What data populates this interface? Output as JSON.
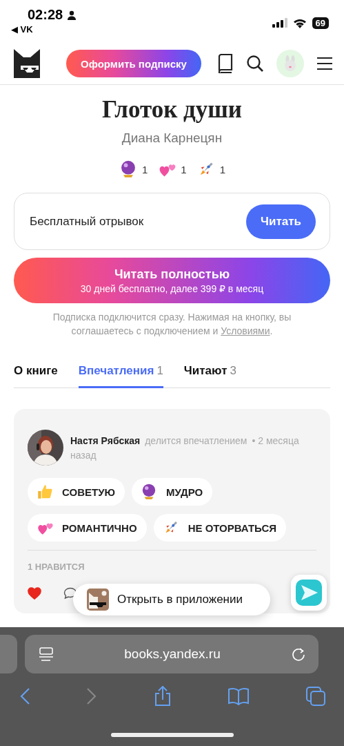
{
  "status_bar": {
    "time": "02:28",
    "back_app": "◀ VK",
    "battery": "69"
  },
  "header": {
    "subscribe_button": "Оформить подписку"
  },
  "book": {
    "title": "Глоток души",
    "author": "Диана Карнецян",
    "reactions": [
      {
        "kind": "crystal-ball",
        "count": "1"
      },
      {
        "kind": "hearts",
        "count": "1"
      },
      {
        "kind": "rocket",
        "count": "1"
      }
    ]
  },
  "free_excerpt": {
    "label": "Бесплатный отрывок",
    "button": "Читать"
  },
  "read_full": {
    "title": "Читать полностью",
    "subtitle": "30 дней бесплатно, далее 399 ₽ в месяц"
  },
  "notice": {
    "text": "Подписка подключится сразу. Нажимая на кнопку, вы соглашаетесь с подключением и",
    "link": "Условиями",
    "end": "."
  },
  "tabs": [
    {
      "label": "О книге",
      "selected": false
    },
    {
      "label": "Впечатления",
      "count": "1",
      "selected": true
    },
    {
      "label": "Читают",
      "count": "3",
      "selected": false
    }
  ],
  "review": {
    "author": "Настя Рябская",
    "action": "делится впечатлением",
    "time": "• 2 месяца назад",
    "tags": [
      {
        "kind": "thumbs-up",
        "label": "СОВЕТУЮ"
      },
      {
        "kind": "crystal-ball",
        "label": "МУДРО"
      },
      {
        "kind": "hearts",
        "label": "РОМАНТИЧНО"
      },
      {
        "kind": "rocket",
        "label": "НЕ ОТОРВАТЬСЯ"
      }
    ],
    "likes": "1 НРАВИТСЯ",
    "liked": true
  },
  "open_in_app": "Открыть в приложении",
  "browser": {
    "url": "books.yandex.ru"
  }
}
